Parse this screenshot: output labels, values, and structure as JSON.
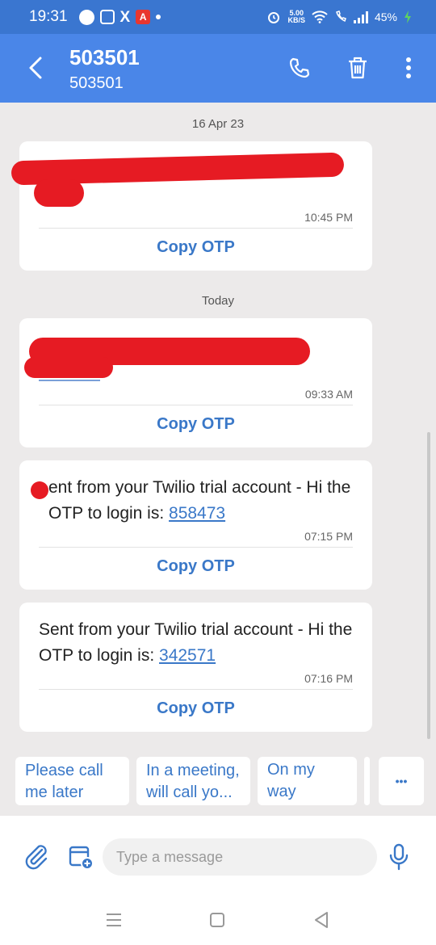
{
  "status_bar": {
    "time": "19:31",
    "speed_value": "5.00",
    "speed_unit": "KB/S",
    "battery": "45%"
  },
  "header": {
    "title": "503501",
    "subtitle": "503501"
  },
  "messages": {
    "date_1": "16 Apr 23",
    "msg_1_time": "10:45 PM",
    "date_2": "Today",
    "msg_2_time": "09:33 AM",
    "msg_3_text": "ent from your Twilio trial account - Hi the OTP to login is: ",
    "msg_3_otp": "858473",
    "msg_3_time": "07:15 PM",
    "msg_4_text": "Sent from your Twilio trial account - Hi the OTP to login is: ",
    "msg_4_otp": "342571",
    "msg_4_time": "07:16 PM",
    "copy_label": "Copy OTP"
  },
  "quick_replies": {
    "reply_1": "Please call me later",
    "reply_2": "In a meeting, will call yo...",
    "reply_3": "On my way",
    "more": "•••"
  },
  "compose": {
    "placeholder": "Type a message"
  },
  "icons": {
    "back": "chevron-left-icon",
    "call": "phone-icon",
    "delete": "trash-icon",
    "more": "more-vertical-icon",
    "attach": "paperclip-icon",
    "schedule": "calendar-add-icon",
    "mic": "microphone-icon"
  },
  "colors": {
    "app_bar": "#4a86e8",
    "status_bar": "#3a76d0",
    "accent": "#3a78c8",
    "background": "#eceaea",
    "redaction": "#e61b23"
  }
}
